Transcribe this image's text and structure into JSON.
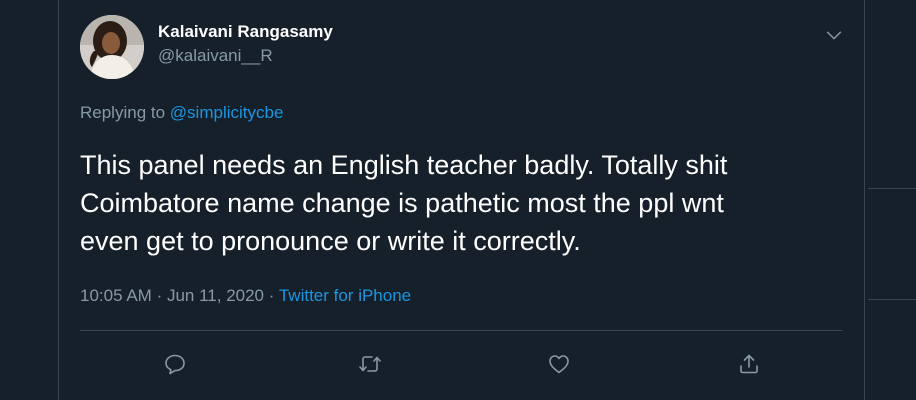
{
  "tweet": {
    "author_name": "Kalaivani Rangasamy",
    "author_handle": "@kalaivani__R",
    "replying_prefix": "Replying to",
    "replying_to": "@simplicitycbe",
    "text_lines": [
      "This panel needs an English teacher badly. Totally shit",
      "Coimbatore name change is pathetic most the ppl wnt",
      "even get to pronounce or write it correctly."
    ],
    "time": "10:05 AM",
    "date": "Jun 11, 2020",
    "separator": "·",
    "source": "Twitter for iPhone"
  },
  "actions": [
    {
      "name": "reply",
      "icon": "reply-icon"
    },
    {
      "name": "retweet",
      "icon": "retweet-icon"
    },
    {
      "name": "like",
      "icon": "heart-icon"
    },
    {
      "name": "share",
      "icon": "share-icon"
    }
  ],
  "colors": {
    "background": "#15202b",
    "text": "#ffffff",
    "secondary": "#8899a6",
    "link": "#1b95e0",
    "border": "#38444d"
  }
}
